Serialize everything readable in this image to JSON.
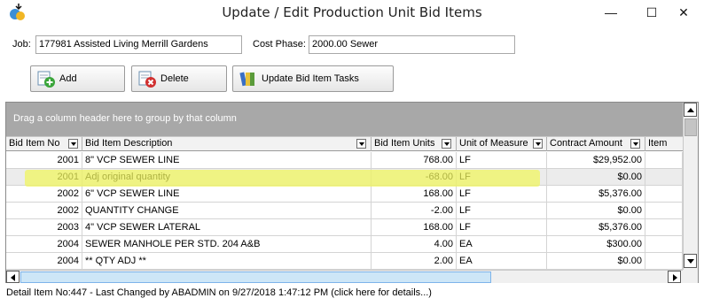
{
  "window": {
    "title": "Update / Edit Production Unit Bid Items",
    "min_glyph": "—",
    "max_glyph": "☐",
    "close_glyph": "✕"
  },
  "form": {
    "job_label": "Job:",
    "job_value": "177981 Assisted Living Merrill Gardens",
    "phase_label": "Cost Phase:",
    "phase_value": "2000.00 Sewer"
  },
  "toolbar": {
    "add_label": "Add",
    "delete_label": "Delete",
    "update_label": "Update Bid Item Tasks"
  },
  "grid": {
    "group_hint": "Drag a column header here to group by that column",
    "columns": [
      {
        "label": "Bid Item No"
      },
      {
        "label": "Bid Item Description"
      },
      {
        "label": "Bid Item Units"
      },
      {
        "label": "Unit of Measure"
      },
      {
        "label": "Contract Amount"
      },
      {
        "label": "Item"
      }
    ],
    "rows": [
      {
        "no": "2001",
        "desc": "8\" VCP SEWER LINE",
        "units": "768.00",
        "uom": "LF",
        "amount": "$29,952.00"
      },
      {
        "no": "2001",
        "desc": "Adj original quantity",
        "units": "-68.00",
        "uom": "LF",
        "amount": "$0.00"
      },
      {
        "no": "2002",
        "desc": "6\" VCP SEWER LINE",
        "units": "168.00",
        "uom": "LF",
        "amount": "$5,376.00"
      },
      {
        "no": "2002",
        "desc": "QUANTITY CHANGE",
        "units": "-2.00",
        "uom": "LF",
        "amount": "$0.00"
      },
      {
        "no": "2003",
        "desc": "4\" VCP SEWER LATERAL",
        "units": "168.00",
        "uom": "LF",
        "amount": "$5,376.00"
      },
      {
        "no": "2004",
        "desc": "SEWER MANHOLE PER STD. 204 A&B",
        "units": "4.00",
        "uom": "EA",
        "amount": "$300.00"
      },
      {
        "no": "2004",
        "desc": "** QTY ADJ **",
        "units": "2.00",
        "uom": "EA",
        "amount": "$0.00"
      }
    ]
  },
  "status": {
    "text": "Detail Item No:447 - Last Changed by ABADMIN on 9/27/2018 1:47:12 PM (click here for details...)"
  },
  "colors": {
    "highlight": "#f0f55a",
    "group_panel": "#a8a8a8",
    "scroll_thumb": "#cde6f7"
  }
}
